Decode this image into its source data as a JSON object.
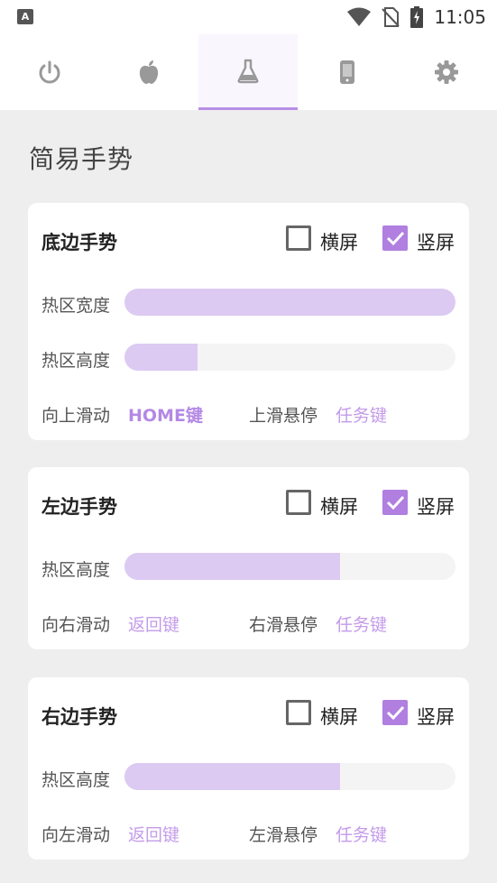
{
  "status": {
    "app_icon": "A",
    "time": "11:05",
    "icons": [
      "wifi-icon",
      "no-sim-icon",
      "battery-charging-icon"
    ]
  },
  "tabs": [
    {
      "icon": "power-icon",
      "active": false
    },
    {
      "icon": "apple-icon",
      "active": false
    },
    {
      "icon": "flask-icon",
      "active": true
    },
    {
      "icon": "phone-icon",
      "active": false
    },
    {
      "icon": "gear-icon",
      "active": false
    }
  ],
  "page_title": "简易手势",
  "cards": [
    {
      "title": "底边手势",
      "landscape_label": "横屏",
      "landscape_checked": false,
      "portrait_label": "竖屏",
      "portrait_checked": true,
      "sliders": [
        {
          "label": "热区宽度",
          "value_fraction": 1.0
        },
        {
          "label": "热区高度",
          "value_fraction": 0.22
        }
      ],
      "swipe_label": "向上滑动",
      "swipe_value": "HOME键",
      "hold_label": "上滑悬停",
      "hold_value": "任务键"
    },
    {
      "title": "左边手势",
      "landscape_label": "横屏",
      "landscape_checked": false,
      "portrait_label": "竖屏",
      "portrait_checked": true,
      "sliders": [
        {
          "label": "热区高度",
          "value_fraction": 0.65
        }
      ],
      "swipe_label": "向右滑动",
      "swipe_value": "返回键",
      "hold_label": "右滑悬停",
      "hold_value": "任务键"
    },
    {
      "title": "右边手势",
      "landscape_label": "横屏",
      "landscape_checked": false,
      "portrait_label": "竖屏",
      "portrait_checked": true,
      "sliders": [
        {
          "label": "热区高度",
          "value_fraction": 0.65
        }
      ],
      "swipe_label": "向左滑动",
      "swipe_value": "返回键",
      "hold_label": "左滑悬停",
      "hold_value": "任务键"
    }
  ],
  "colors": {
    "accent": "#b07fe0",
    "slider_fill": "#dccaf2",
    "link": "#c49bea",
    "background": "#eeeeee"
  }
}
